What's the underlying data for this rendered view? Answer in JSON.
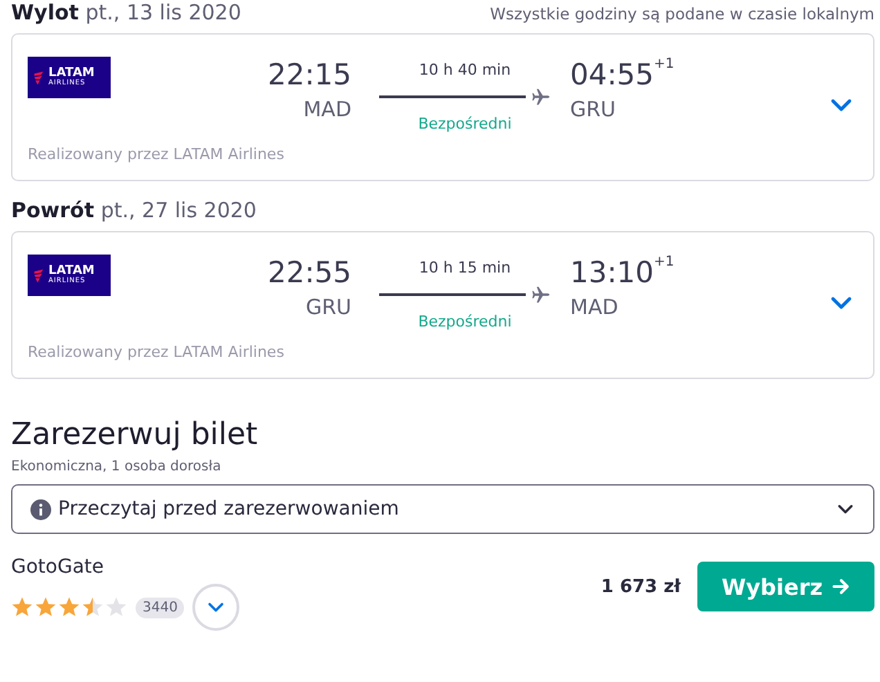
{
  "note": "Wszystkie godziny są podane w czasie lokalnym",
  "legs": [
    {
      "label": "Wylot",
      "date": "pt., 13 lis 2020",
      "logo": {
        "name": "LATAM",
        "sub": "AIRLINES"
      },
      "dep_time": "22:15",
      "dep_code": "MAD",
      "duration": "10 h 40 min",
      "stops": "Bezpośredni",
      "arr_time": "04:55",
      "arr_offset": "+1",
      "arr_code": "GRU",
      "operator": "Realizowany przez LATAM Airlines",
      "expanded": false
    },
    {
      "label": "Powrót",
      "date": "pt., 27 lis 2020",
      "logo": {
        "name": "LATAM",
        "sub": "AIRLINES"
      },
      "dep_time": "22:55",
      "dep_code": "GRU",
      "duration": "10 h 15 min",
      "stops": "Bezpośredni",
      "arr_time": "13:10",
      "arr_offset": "+1",
      "arr_code": "MAD",
      "operator": "Realizowany przez LATAM Airlines",
      "expanded": false
    }
  ],
  "booking": {
    "title": "Zarezerwuj bilet",
    "subtitle": "Ekonomiczna, 1 osoba dorosła",
    "notice": "Przeczytaj przed zarezerwowaniem",
    "provider": "GotoGate",
    "stars": 3.5,
    "reviews": "3440",
    "price": "1 673 zł",
    "button": "Wybierz"
  }
}
